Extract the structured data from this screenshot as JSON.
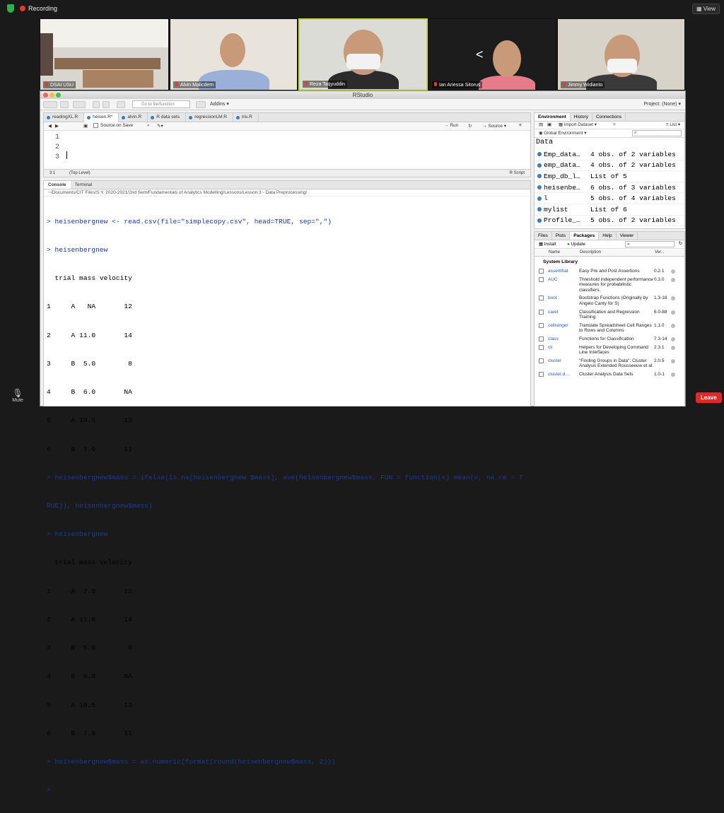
{
  "zoom": {
    "recording_label": "Recording",
    "view_label": "View",
    "mute_label": "Mute",
    "leave_label": "Leave",
    "participants": [
      {
        "name": "DSAI USU"
      },
      {
        "name": "Alvin Malicdem"
      },
      {
        "name": "Reza Taqyuddin"
      },
      {
        "name": "Ian Ariessa Sitorus"
      },
      {
        "name": "Jimmy Widianto"
      }
    ]
  },
  "rstudio": {
    "window_title": "RStudio",
    "goto_placeholder": "Go to file/function",
    "addins_label": "Addins",
    "project_label": "Project: (None)",
    "editor": {
      "tabs": [
        "readingXL.R",
        "heisen.R*",
        "alvin.R",
        "R data sets",
        "regressionLM.R",
        "iris.R"
      ],
      "source_on_save": "Source on Save",
      "run_label": "Run",
      "source_label": "Source",
      "line_numbers": [
        "1",
        "2",
        "3"
      ],
      "status_position": "3:1",
      "status_scope": "(Top Level)",
      "status_type": "R Script"
    },
    "console": {
      "tabs": [
        "Console",
        "Terminal"
      ],
      "path": "~/Documents/CIT Files/S.Y. 2020-2021/2nd Sem/Fundamentals of Analytics Modelling/Lessons/Lesson 3 - Data Preprocessing/",
      "lines": [
        "> heisenbergnew <- read.csv(file=\"simplecopy.csv\", head=TRUE, sep=\",\")",
        "> heisenbergnew",
        "  trial mass velocity",
        "1     A   NA       12",
        "2     A 11.0       14",
        "3     B  5.0        8",
        "4     B  6.0       NA",
        "5     A 10.5       13",
        "6     B  7.0       11",
        "> heisenbergnew$mass = ifelse(is.na(heisenbergnew $mass), ave(heisenbergnew$mass, FUN = function(x) mean(x, na.rm = T",
        "RUE)), heisenbergnew$mass)",
        "> heisenbergnew",
        "  trial mass velocity",
        "1     A  7.9       12",
        "2     A 11.0       14",
        "3     B  5.0        8",
        "4     B  6.0       NA",
        "5     A 10.5       13",
        "6     B  7.0       11",
        "> heisenbergnew$mass = as.numeric(format(round(heisenbergnew$mass, 2)))",
        "> "
      ]
    },
    "environment": {
      "tabs": [
        "Environment",
        "History",
        "Connections"
      ],
      "import_label": "Import Dataset",
      "list_label": "List",
      "scope_label": "Global Environment",
      "data_header": "Data",
      "rows": [
        {
          "name": "Emp_data…",
          "value": "4 obs. of 2 variables"
        },
        {
          "name": "emp_data…",
          "value": "4 obs. of 2 variables"
        },
        {
          "name": "Emp_db_l…",
          "value": "List of 5"
        },
        {
          "name": "heisenbe…",
          "value": "6 obs. of 3 variables"
        },
        {
          "name": "l",
          "value": "5 obs. of 4 variables"
        },
        {
          "name": "mylist",
          "value": "List of 6"
        },
        {
          "name": "Profile_…",
          "value": "5 obs. of 2 variables"
        }
      ]
    },
    "packages": {
      "tabs": [
        "Files",
        "Plots",
        "Packages",
        "Help",
        "Viewer"
      ],
      "install_label": "Install",
      "update_label": "Update",
      "col_name": "Name",
      "col_desc": "Description",
      "col_ver": "Ver...",
      "section": "System Library",
      "rows": [
        {
          "name": "assertthat",
          "desc": "Easy Pre and Post Assertions",
          "ver": "0.2.1"
        },
        {
          "name": "AUC",
          "desc": "Threshold independent performance measures for probabilistic classifiers.",
          "ver": "0.3.0"
        },
        {
          "name": "boot",
          "desc": "Bootstrap Functions (Originally by Angelo Canty for S)",
          "ver": "1.3-18"
        },
        {
          "name": "caret",
          "desc": "Classification and Regression Training",
          "ver": "6.0-88"
        },
        {
          "name": "cellranger",
          "desc": "Translate Spreadsheet Cell Ranges to Rows and Columns",
          "ver": "1.1.0"
        },
        {
          "name": "class",
          "desc": "Functions for Classification",
          "ver": "7.3-14"
        },
        {
          "name": "cli",
          "desc": "Helpers for Developing Command Line Interfaces",
          "ver": "2.3.1"
        },
        {
          "name": "cluster",
          "desc": "\"Finding Groups in Data\": Cluster Analysis Extended Rousseeuw et al.",
          "ver": "2.0.5"
        },
        {
          "name": "cluster.d…",
          "desc": "Cluster Analysis Data Sets",
          "ver": "1.0-1"
        }
      ]
    }
  }
}
